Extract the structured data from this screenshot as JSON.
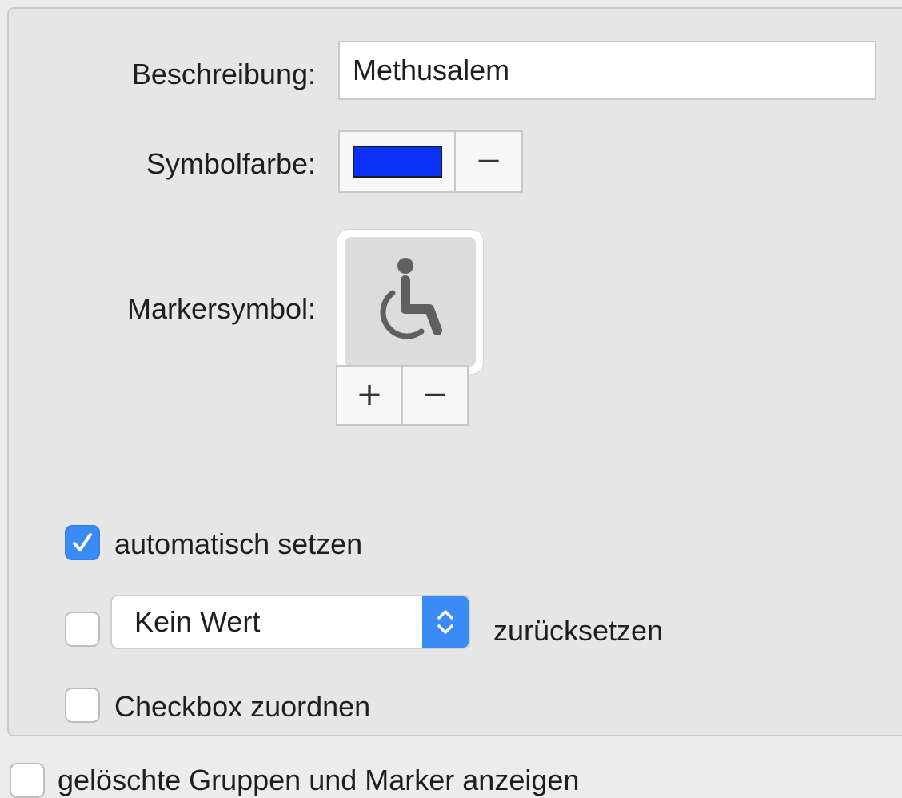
{
  "form": {
    "description_label": "Beschreibung:",
    "description_value": "Methusalem",
    "symbol_color_label": "Symbolfarbe:",
    "symbol_color": "#0a31f5",
    "symbol_color_remove": "−",
    "marker_symbol_label": "Markersymbol:",
    "marker_symbol_icon": "wheelchair-icon",
    "marker_add": "+",
    "marker_remove": "−"
  },
  "options": {
    "auto_set": {
      "label": "automatisch setzen",
      "checked": true
    },
    "reset": {
      "checked": false,
      "selected_value": "Kein Wert",
      "label": "zurücksetzen"
    },
    "assign_checkbox": {
      "label": "Checkbox zuordnen",
      "checked": false
    }
  },
  "footer": {
    "show_deleted": {
      "label": "gelöschte Gruppen und Marker anzeigen",
      "checked": false
    }
  },
  "colors": {
    "accent": "#3a8bf5"
  }
}
